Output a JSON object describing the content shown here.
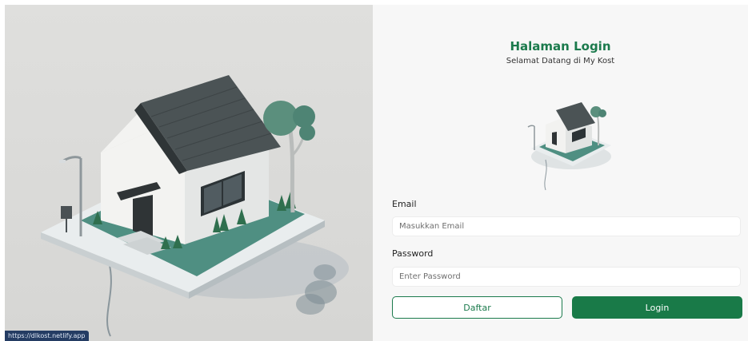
{
  "login": {
    "title": "Halaman Login",
    "subtitle": "Selamat Datang di My Kost",
    "email_label": "Email",
    "email_placeholder": "Masukkan Email",
    "email_value": "",
    "password_label": "Password",
    "password_placeholder": "Enter Password",
    "password_value": "",
    "register_button": "Daftar",
    "login_button": "Login"
  },
  "status_bar": {
    "url": "https://dlkost.netlify.app"
  },
  "colors": {
    "brand_green": "#1b7a4c",
    "button_green": "#197a48",
    "panel_bg": "#f7f7f7",
    "hero_bg": "#d9d9d7"
  },
  "icons": {
    "hero": "isometric-house-illustration",
    "thumb": "house-logo-icon"
  }
}
